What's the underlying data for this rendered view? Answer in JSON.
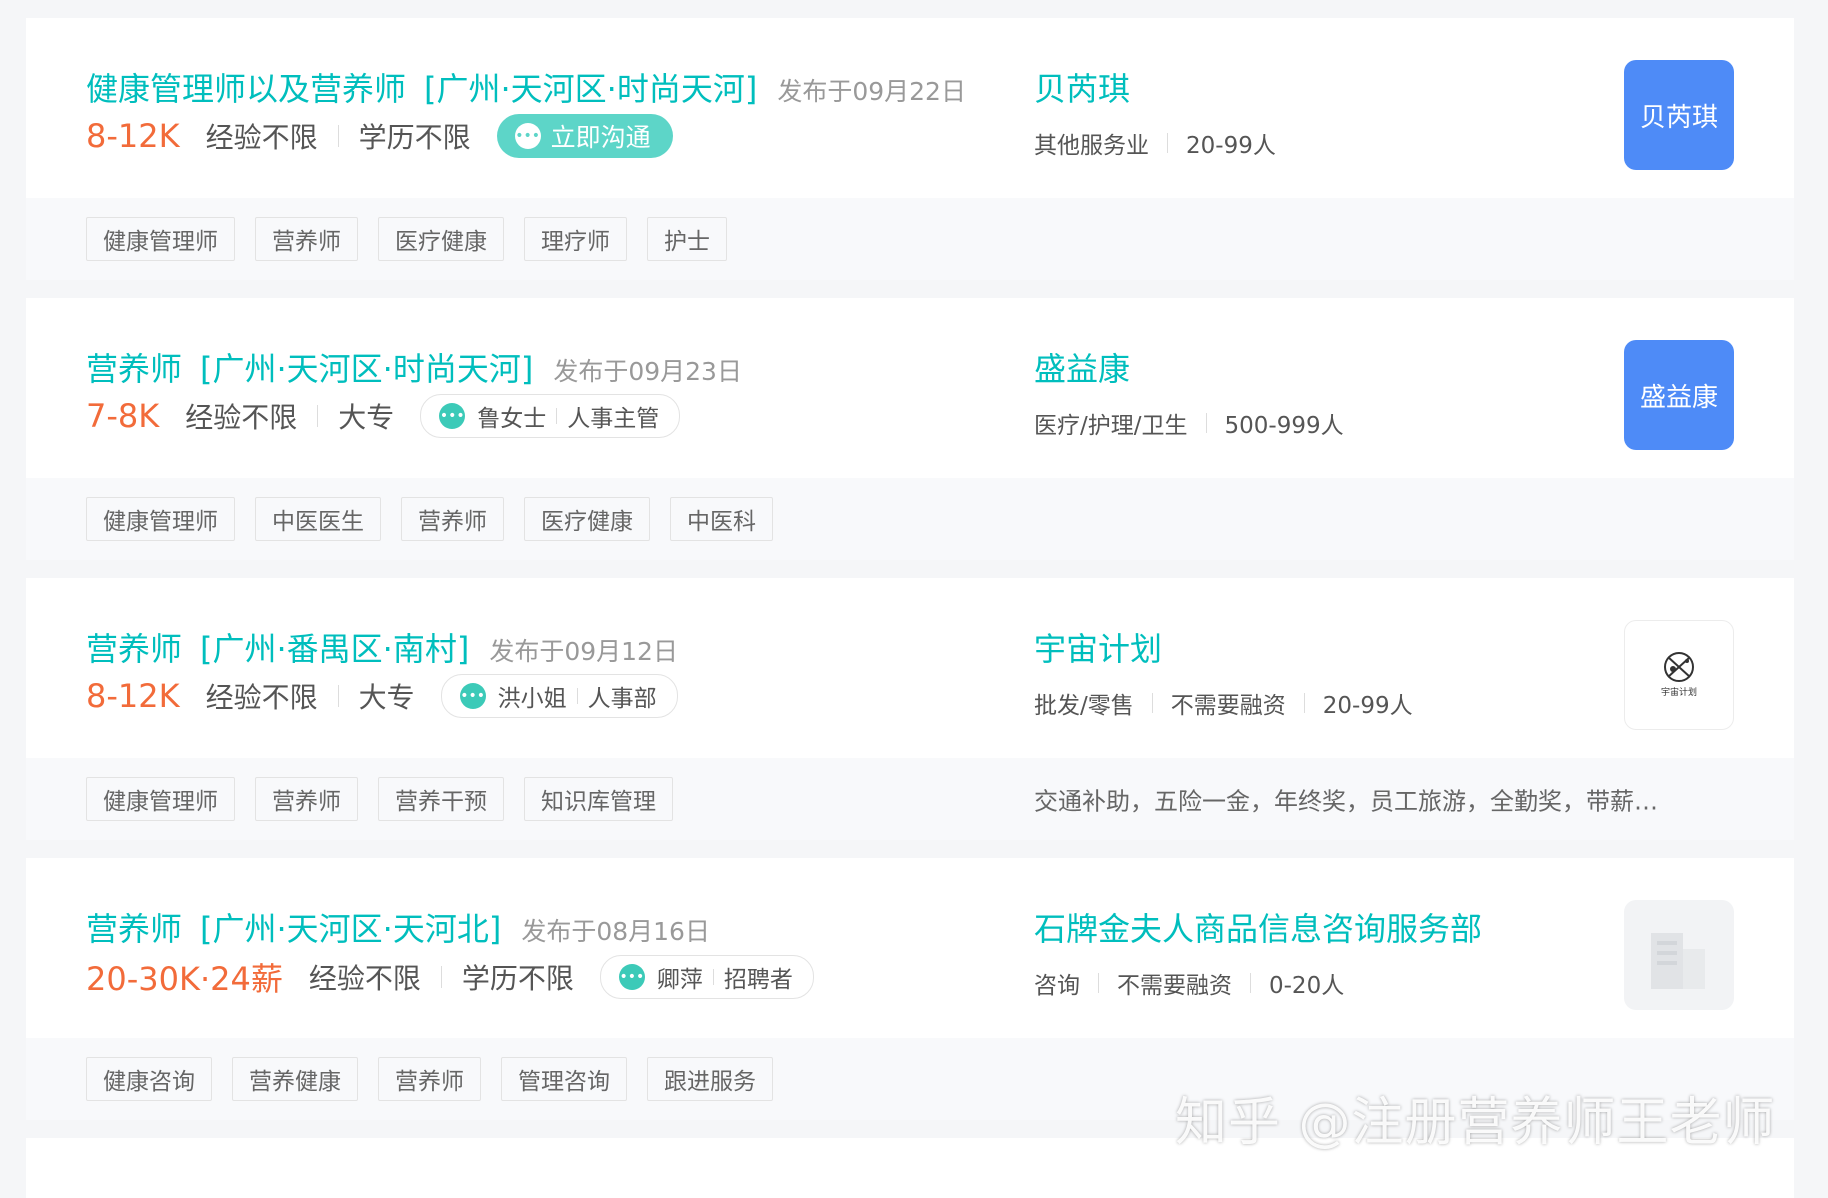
{
  "jobs": [
    {
      "name": "健康管理师以及营养师",
      "area": "[广州·天河区·时尚天河]",
      "pub": "发布于09月22日",
      "salary": "8-12K",
      "exp": "经验不限",
      "edu": "学历不限",
      "chat_label": "立即沟通",
      "company": {
        "name": "贝芮琪",
        "industry": "其他服务业",
        "size": "20-99人",
        "logo_text": "贝芮琪"
      },
      "tags": [
        "健康管理师",
        "营养师",
        "医疗健康",
        "理疗师",
        "护士"
      ]
    },
    {
      "name": "营养师",
      "area": "[广州·天河区·时尚天河]",
      "pub": "发布于09月23日",
      "salary": "7-8K",
      "exp": "经验不限",
      "edu": "大专",
      "contact_name": "鲁女士",
      "contact_role": "人事主管",
      "company": {
        "name": "盛益康",
        "industry": "医疗/护理/卫生",
        "size": "500-999人",
        "logo_text": "盛益康"
      },
      "tags": [
        "健康管理师",
        "中医医生",
        "营养师",
        "医疗健康",
        "中医科"
      ]
    },
    {
      "name": "营养师",
      "area": "[广州·番禺区·南村]",
      "pub": "发布于09月12日",
      "salary": "8-12K",
      "exp": "经验不限",
      "edu": "大专",
      "contact_name": "洪小姐",
      "contact_role": "人事部",
      "company": {
        "name": "宇宙计划",
        "industry": "批发/零售",
        "funding": "不需要融资",
        "size": "20-99人",
        "logo_text": "宇宙计划"
      },
      "tags": [
        "健康管理师",
        "营养师",
        "营养干预",
        "知识库管理"
      ],
      "welfare": "交通补助，五险一金，年终奖，员工旅游，全勤奖，带薪…"
    },
    {
      "name": "营养师",
      "area": "[广州·天河区·天河北]",
      "pub": "发布于08月16日",
      "salary": "20-30K·24薪",
      "exp": "经验不限",
      "edu": "学历不限",
      "contact_name": "卿萍",
      "contact_role": "招聘者",
      "company": {
        "name": "石牌金夫人商品信息咨询服务部",
        "industry": "咨询",
        "funding": "不需要融资",
        "size": "0-20人"
      },
      "tags": [
        "健康咨询",
        "营养健康",
        "营养师",
        "管理咨询",
        "跟进服务"
      ]
    }
  ],
  "watermark": "知乎 @注册营养师王老师",
  "colors": {
    "accent": "#00bebd",
    "salary": "#f26b3a",
    "logo_blue": "#4e8bf7"
  }
}
